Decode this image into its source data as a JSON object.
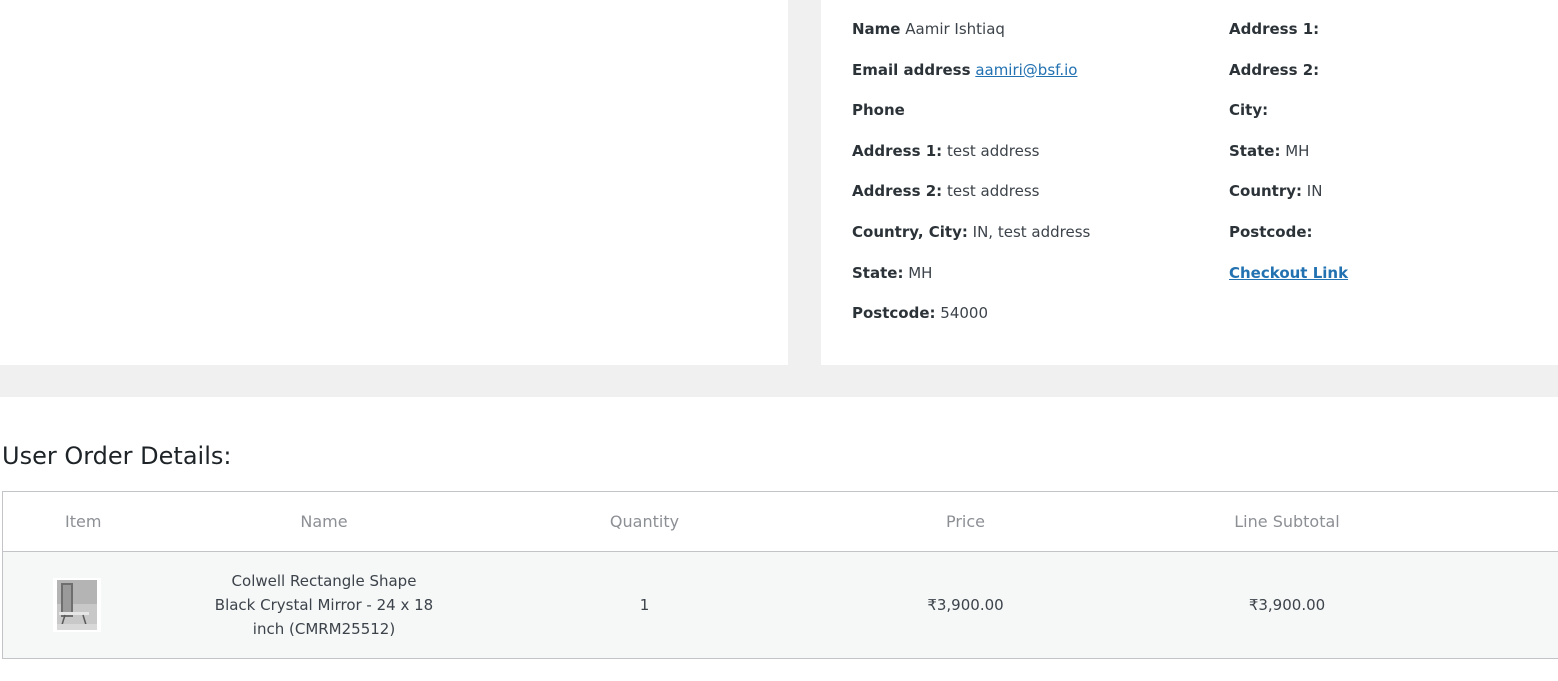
{
  "customer": {
    "name_label": "Name",
    "name_value": "Aamir Ishtiaq",
    "email_label": "Email address",
    "email_value": "aamiri@bsf.io",
    "phone_label": "Phone",
    "address1_label": "Address 1:",
    "address1_value": "test address",
    "address2_label": "Address 2:",
    "address2_value": "test address",
    "country_city_label": "Country, City:",
    "country_city_value": "IN, test address",
    "state_label": "State:",
    "state_value": "MH",
    "postcode_label": "Postcode:",
    "postcode_value": "54000"
  },
  "shipping": {
    "address1_label": "Address 1:",
    "address2_label": "Address 2:",
    "city_label": "City:",
    "state_label": "State:",
    "state_value": "MH",
    "country_label": "Country:",
    "country_value": "IN",
    "postcode_label": "Postcode:",
    "checkout_link_label": "Checkout Link"
  },
  "order": {
    "title": "User Order Details:",
    "columns": [
      "Item",
      "Name",
      "Quantity",
      "Price",
      "Line Subtotal"
    ],
    "rows": [
      {
        "thumbnail_icon": "mirror-product-thumbnail",
        "name": "Colwell Rectangle Shape Black Crystal Mirror - 24 x 18 inch (CMRM25512)",
        "quantity": "1",
        "price": "₹3,900.00",
        "line_subtotal": "₹3,900.00"
      }
    ]
  },
  "colors": {
    "link": "#2271b1",
    "background": "#f0f0f1",
    "panel": "#ffffff",
    "row": "#f6f7f7"
  }
}
